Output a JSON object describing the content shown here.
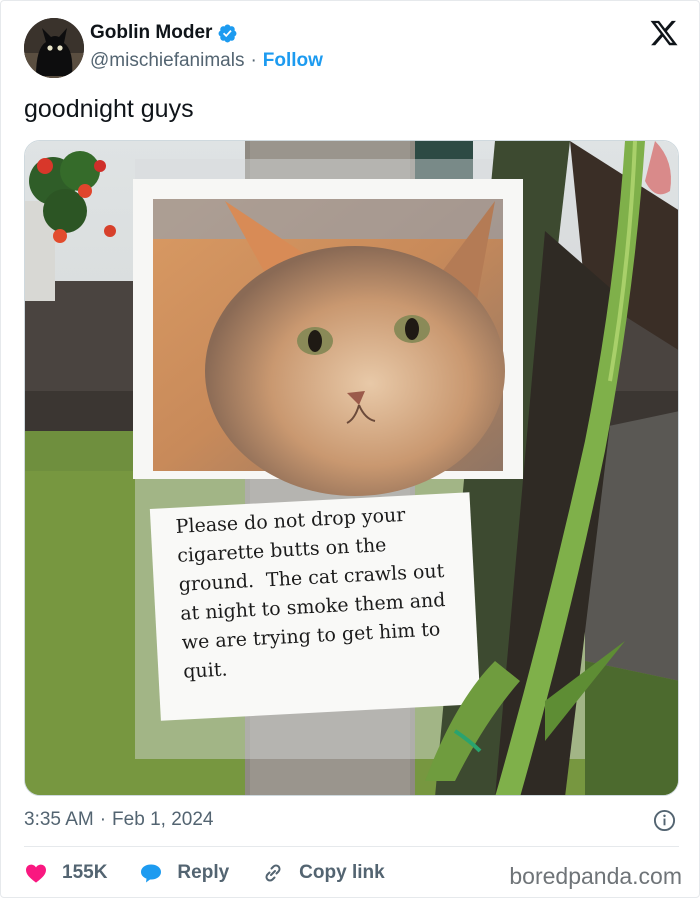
{
  "author": {
    "display_name": "Goblin Moder",
    "handle": "@mischiefanimals",
    "separator": "·",
    "follow_label": "Follow",
    "verified": true
  },
  "tweet": {
    "text": "goodnight guys"
  },
  "media": {
    "sign_text_lines": [
      "Please do not drop your",
      "cigarette butts on the",
      "ground.  The cat crawls out",
      "at night to smoke them and",
      "we are trying to get him to",
      "quit."
    ]
  },
  "meta": {
    "time": "3:35 AM",
    "separator": "·",
    "date": "Feb 1, 2024"
  },
  "actions": {
    "like_count": "155K",
    "reply_label": "Reply",
    "copy_link_label": "Copy link"
  },
  "watermark": "boredpanda.com",
  "colors": {
    "accent": "#1d9bf0",
    "like": "#f91880",
    "reply": "#1d9bf0",
    "muted": "#536471",
    "text": "#0f1419"
  },
  "icons": [
    "verified-badge-icon",
    "x-logo-icon",
    "info-icon",
    "heart-icon",
    "reply-bubble-icon",
    "link-icon"
  ]
}
